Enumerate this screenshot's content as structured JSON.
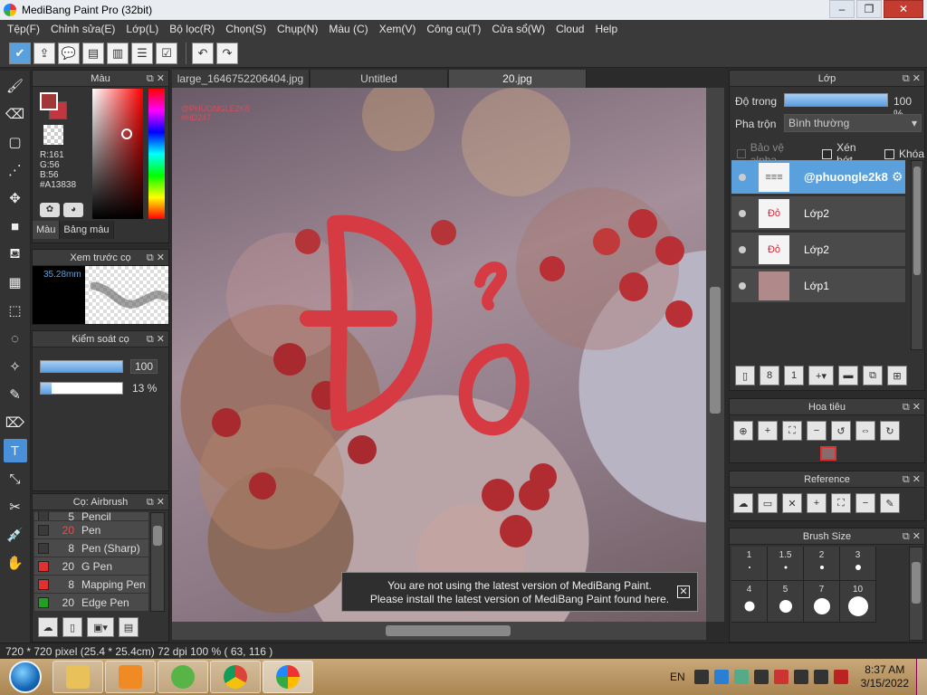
{
  "window": {
    "title": "MediBang Paint Pro (32bit)",
    "minimize": "–",
    "restore": "❐",
    "close": "✕"
  },
  "menu": [
    "Tệp(F)",
    "Chỉnh sửa(E)",
    "Lớp(L)",
    "Bộ lọc(R)",
    "Chọn(S)",
    "Chụp(N)",
    "Màu (C)",
    "Xem(V)",
    "Công cụ(T)",
    "Cửa sổ(W)",
    "Cloud",
    "Help"
  ],
  "color_panel": {
    "title": "Màu",
    "r": "R:161",
    "g": "G:56",
    "b": "B:56",
    "hex": "#A13838",
    "tab_color": "Màu",
    "tab_palette": "Bảng màu",
    "foreground": "#a13838"
  },
  "brush_preview": {
    "title": "Xem trước cọ",
    "size": "35.28mm"
  },
  "brush_control": {
    "title": "Kiểm soát cọ",
    "size_value": "100",
    "size_fraction": 1.0,
    "opacity_value": "13 %",
    "opacity_fraction": 0.13
  },
  "brush_panel": {
    "title": "Cọ: Airbrush",
    "items": [
      {
        "size": "5",
        "name": "Pencil",
        "color": "#3a3a3a",
        "size_color": "#ddd"
      },
      {
        "size": "20",
        "name": "Pen",
        "color": "#3a3a3a",
        "size_color": "#e05050"
      },
      {
        "size": "8",
        "name": "Pen (Sharp)",
        "color": "#3a3a3a",
        "size_color": "#ddd"
      },
      {
        "size": "20",
        "name": "G Pen",
        "color": "#e03030",
        "size_color": "#ddd"
      },
      {
        "size": "8",
        "name": "Mapping Pen",
        "color": "#e03030",
        "size_color": "#ddd"
      },
      {
        "size": "20",
        "name": "Edge Pen",
        "color": "#20a020",
        "size_color": "#ddd"
      }
    ]
  },
  "doc_tabs": [
    "large_1646752206404.jpg",
    "Untitled",
    "20.jpg"
  ],
  "canvas": {
    "watermark_line1": "@PHUONGLE2K8",
    "watermark_line2": "#HD247",
    "drawn_text": "Đỏ"
  },
  "notice": {
    "line1": "You are not using the latest version of MediBang Paint.",
    "line2": "Please install the latest version of MediBang Paint found here.",
    "close": "✕"
  },
  "layer_panel": {
    "title": "Lớp",
    "opacity_label": "Độ trong",
    "opacity_value": "100 %",
    "blend_label": "Pha trộn",
    "blend_value": "Bình thường",
    "protect_alpha": "Bảo vệ alpha",
    "clipping": "Xén bớt",
    "lock": "Khóa",
    "layers": [
      {
        "name": "@phuongle2k8",
        "thumb": "≡≡≡",
        "active": true
      },
      {
        "name": "Lớp2",
        "thumb": "Đỏ",
        "active": false
      },
      {
        "name": "Lớp2",
        "thumb": "Đỏ",
        "active": false
      },
      {
        "name": "Lớp1",
        "thumb": "",
        "active": false
      }
    ]
  },
  "navigator_panel": {
    "title": "Hoa tiêu"
  },
  "reference_panel": {
    "title": "Reference"
  },
  "brush_size_panel": {
    "title": "Brush Size",
    "sizes": [
      "1",
      "1.5",
      "2",
      "3",
      "4",
      "5",
      "7",
      "10"
    ]
  },
  "status": {
    "text": "720 * 720 pixel  (25.4 * 25.4cm)  72 dpi  100 %  ( 63, 116 )"
  },
  "taskbar": {
    "lang": "EN",
    "time": "8:37 AM",
    "date": "3/15/2022"
  },
  "icons": {
    "panel_popout": "⧉",
    "panel_close": "✕"
  }
}
